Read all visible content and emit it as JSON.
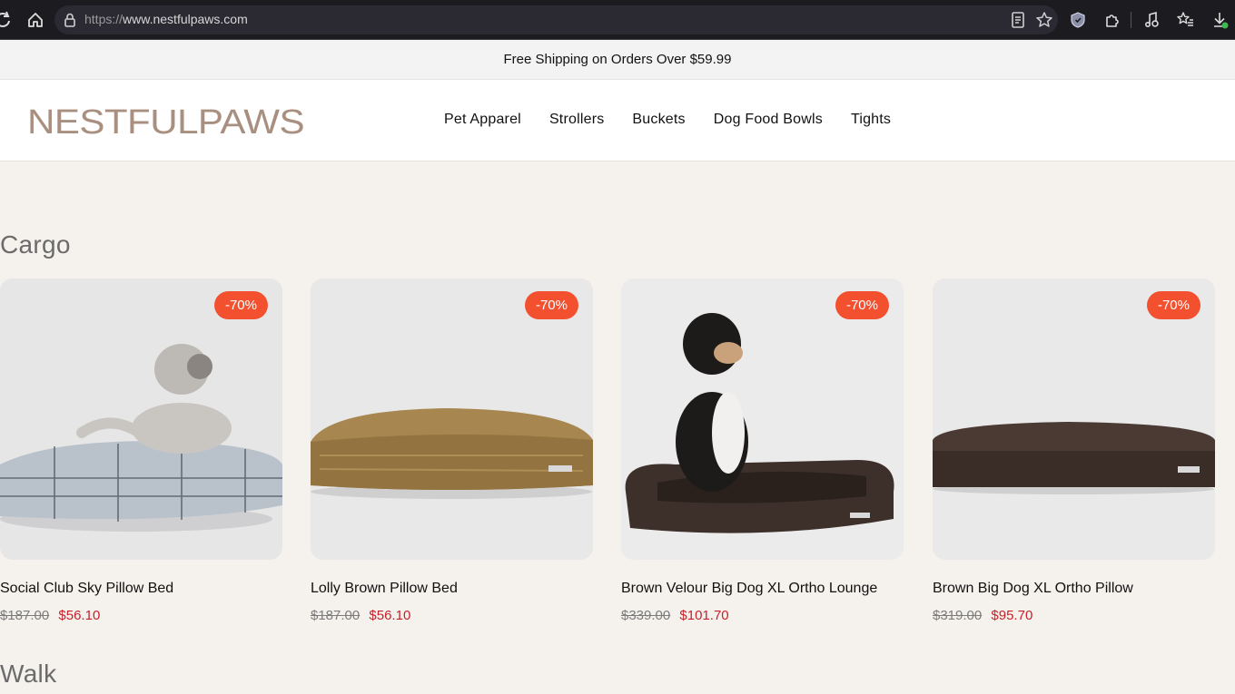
{
  "browser": {
    "url_protocol": "https://",
    "url_host": "www.nestfulpaws.com"
  },
  "announcement": "Free Shipping on Orders Over $59.99",
  "brand": {
    "logo_text": "NESTFULPAWS",
    "logo_color": "#a98f80"
  },
  "nav": [
    "Pet Apparel",
    "Strollers",
    "Buckets",
    "Dog Food Bowls",
    "Tights"
  ],
  "sections": {
    "cargo": {
      "title": "Cargo",
      "products": [
        {
          "name": "Social Club Sky Pillow Bed",
          "old_price": "$187.00",
          "price": "$56.10",
          "badge": "-70%"
        },
        {
          "name": "Lolly Brown Pillow Bed",
          "old_price": "$187.00",
          "price": "$56.10",
          "badge": "-70%"
        },
        {
          "name": "Brown Velour Big Dog XL Ortho Lounge",
          "old_price": "$339.00",
          "price": "$101.70",
          "badge": "-70%"
        },
        {
          "name": "Brown Big Dog XL Ortho Pillow",
          "old_price": "$319.00",
          "price": "$95.70",
          "badge": "-70%"
        }
      ]
    },
    "walk": {
      "title": "Walk"
    }
  },
  "colors": {
    "sale_badge": "#f2502f",
    "sale_price": "#c8202a",
    "page_bg": "#f5f2ed"
  }
}
